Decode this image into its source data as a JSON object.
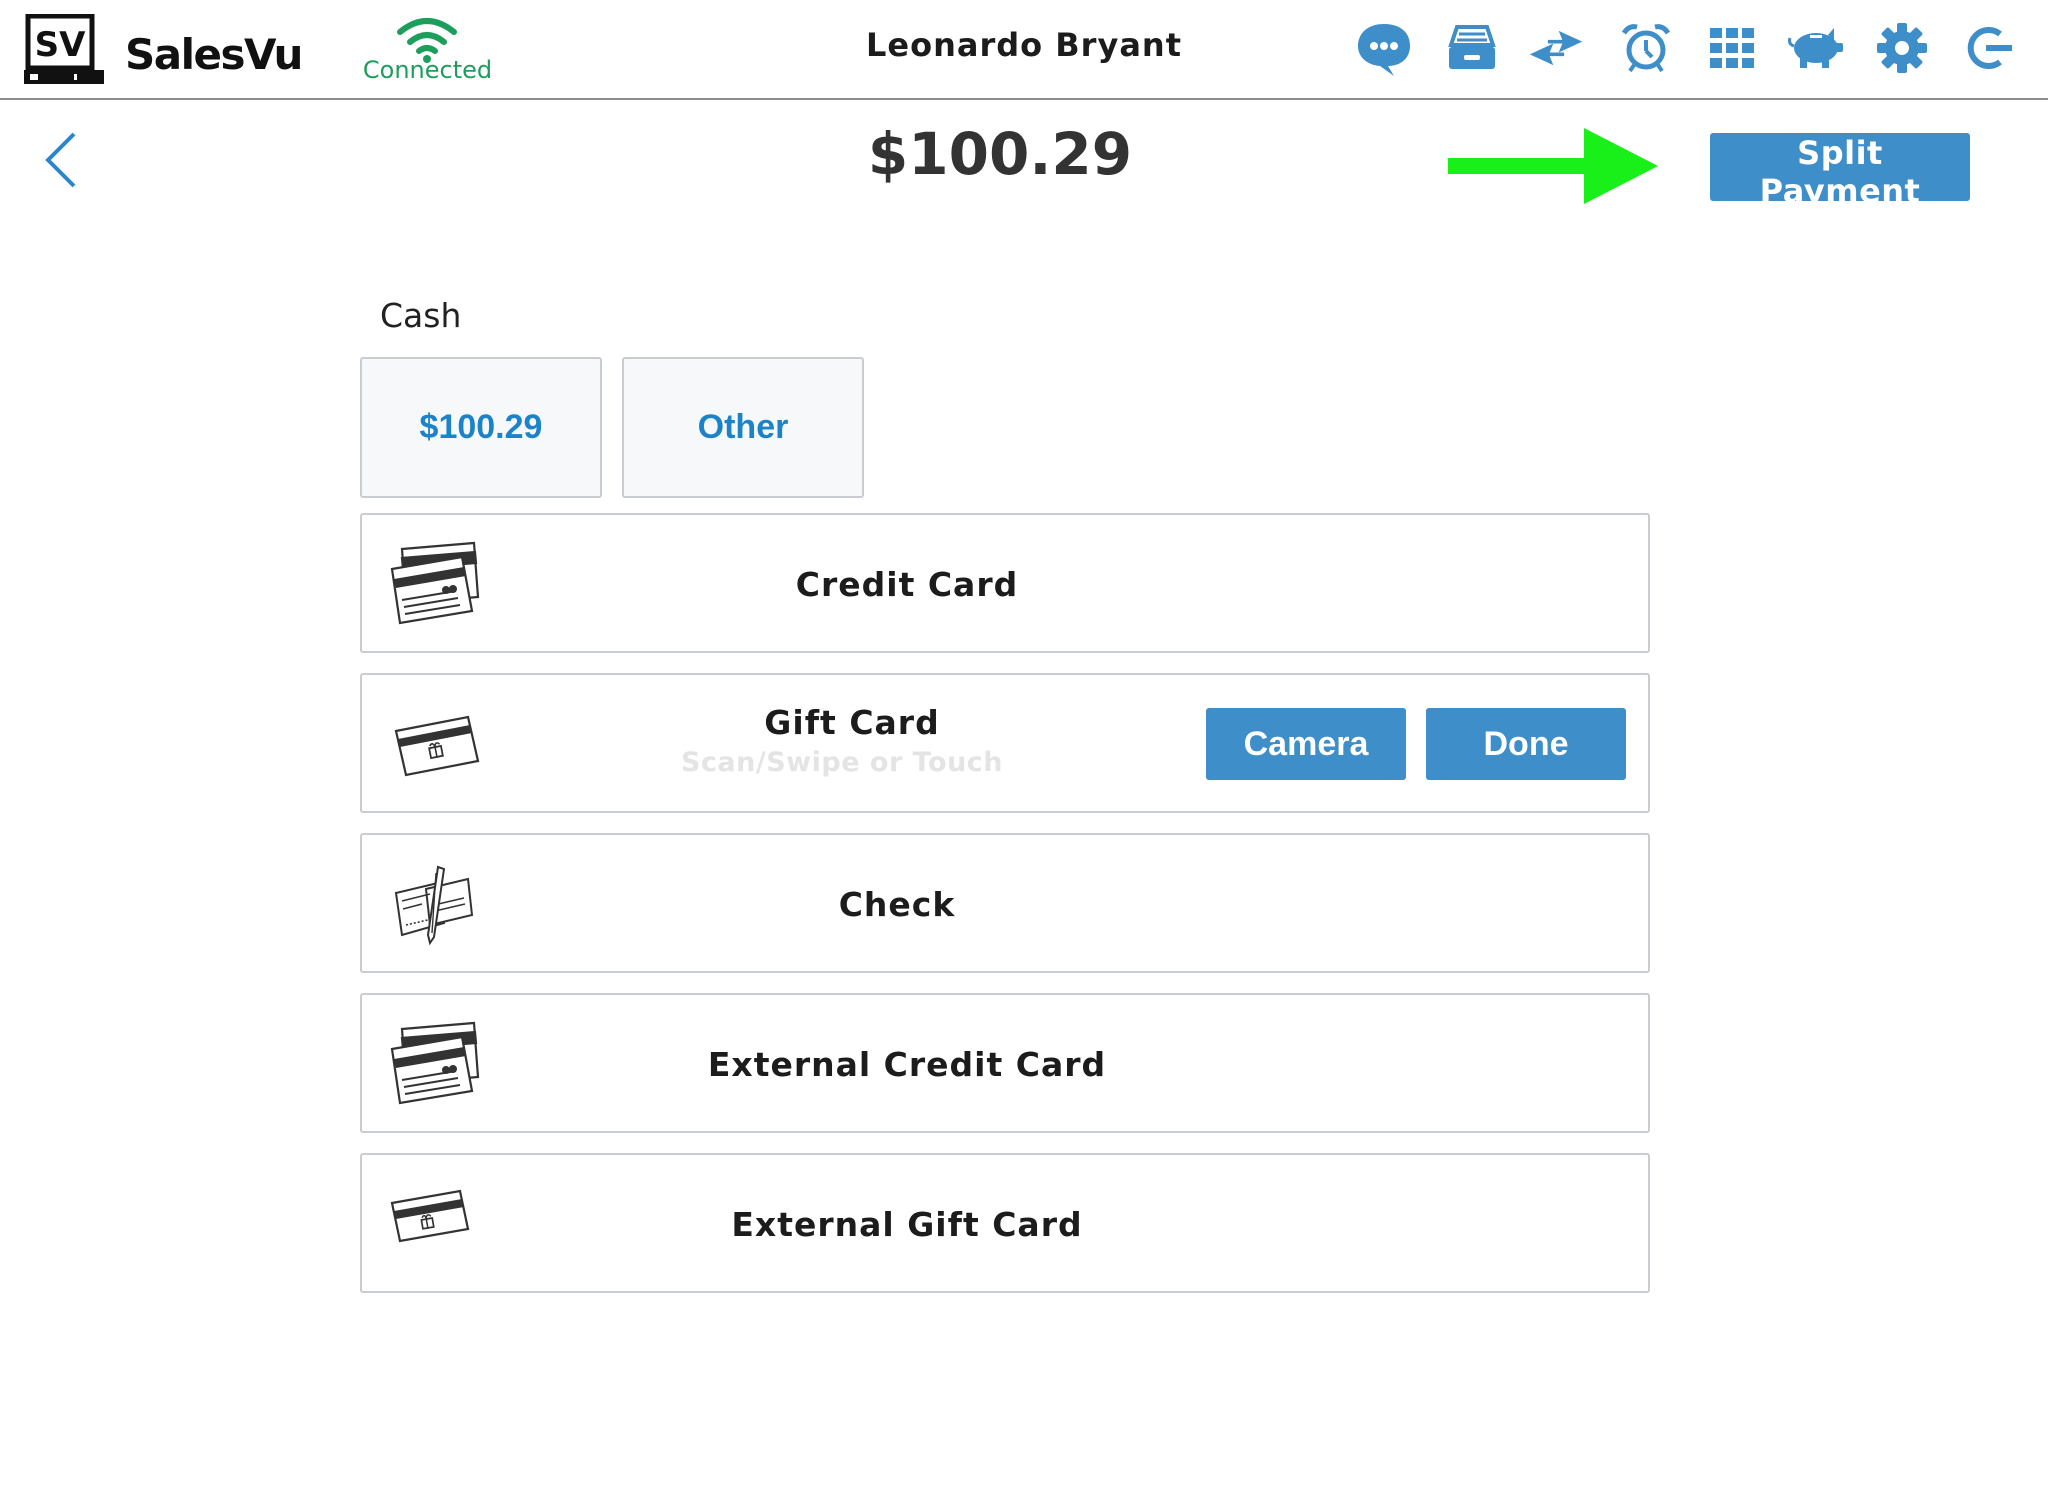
{
  "header": {
    "logo_text": "SV",
    "app_name": "SalesVu",
    "connection_status": "Connected",
    "user_name": "Leonardo Bryant",
    "icons": [
      "chat-icon",
      "cash-drawer-icon",
      "transfer-icon",
      "alarm-clock-icon",
      "grid-icon",
      "piggy-bank-icon",
      "gear-icon",
      "logout-icon"
    ]
  },
  "payment": {
    "total": "$100.29",
    "split_label": "Split Payment"
  },
  "cash": {
    "section_label": "Cash",
    "exact_amount": "$100.29",
    "other_label": "Other"
  },
  "methods": {
    "credit_card": "Credit Card",
    "gift_card": "Gift Card",
    "gift_card_hint": "Scan/Swipe or Touch",
    "camera_label": "Camera",
    "done_label": "Done",
    "check": "Check",
    "external_credit_card": "External Credit Card",
    "external_gift_card": "External Gift Card"
  },
  "colors": {
    "accent": "#3e8ec9",
    "link_blue": "#1d83c9",
    "connected_green": "#1e9e5c",
    "annotation_arrow": "#19f019"
  }
}
